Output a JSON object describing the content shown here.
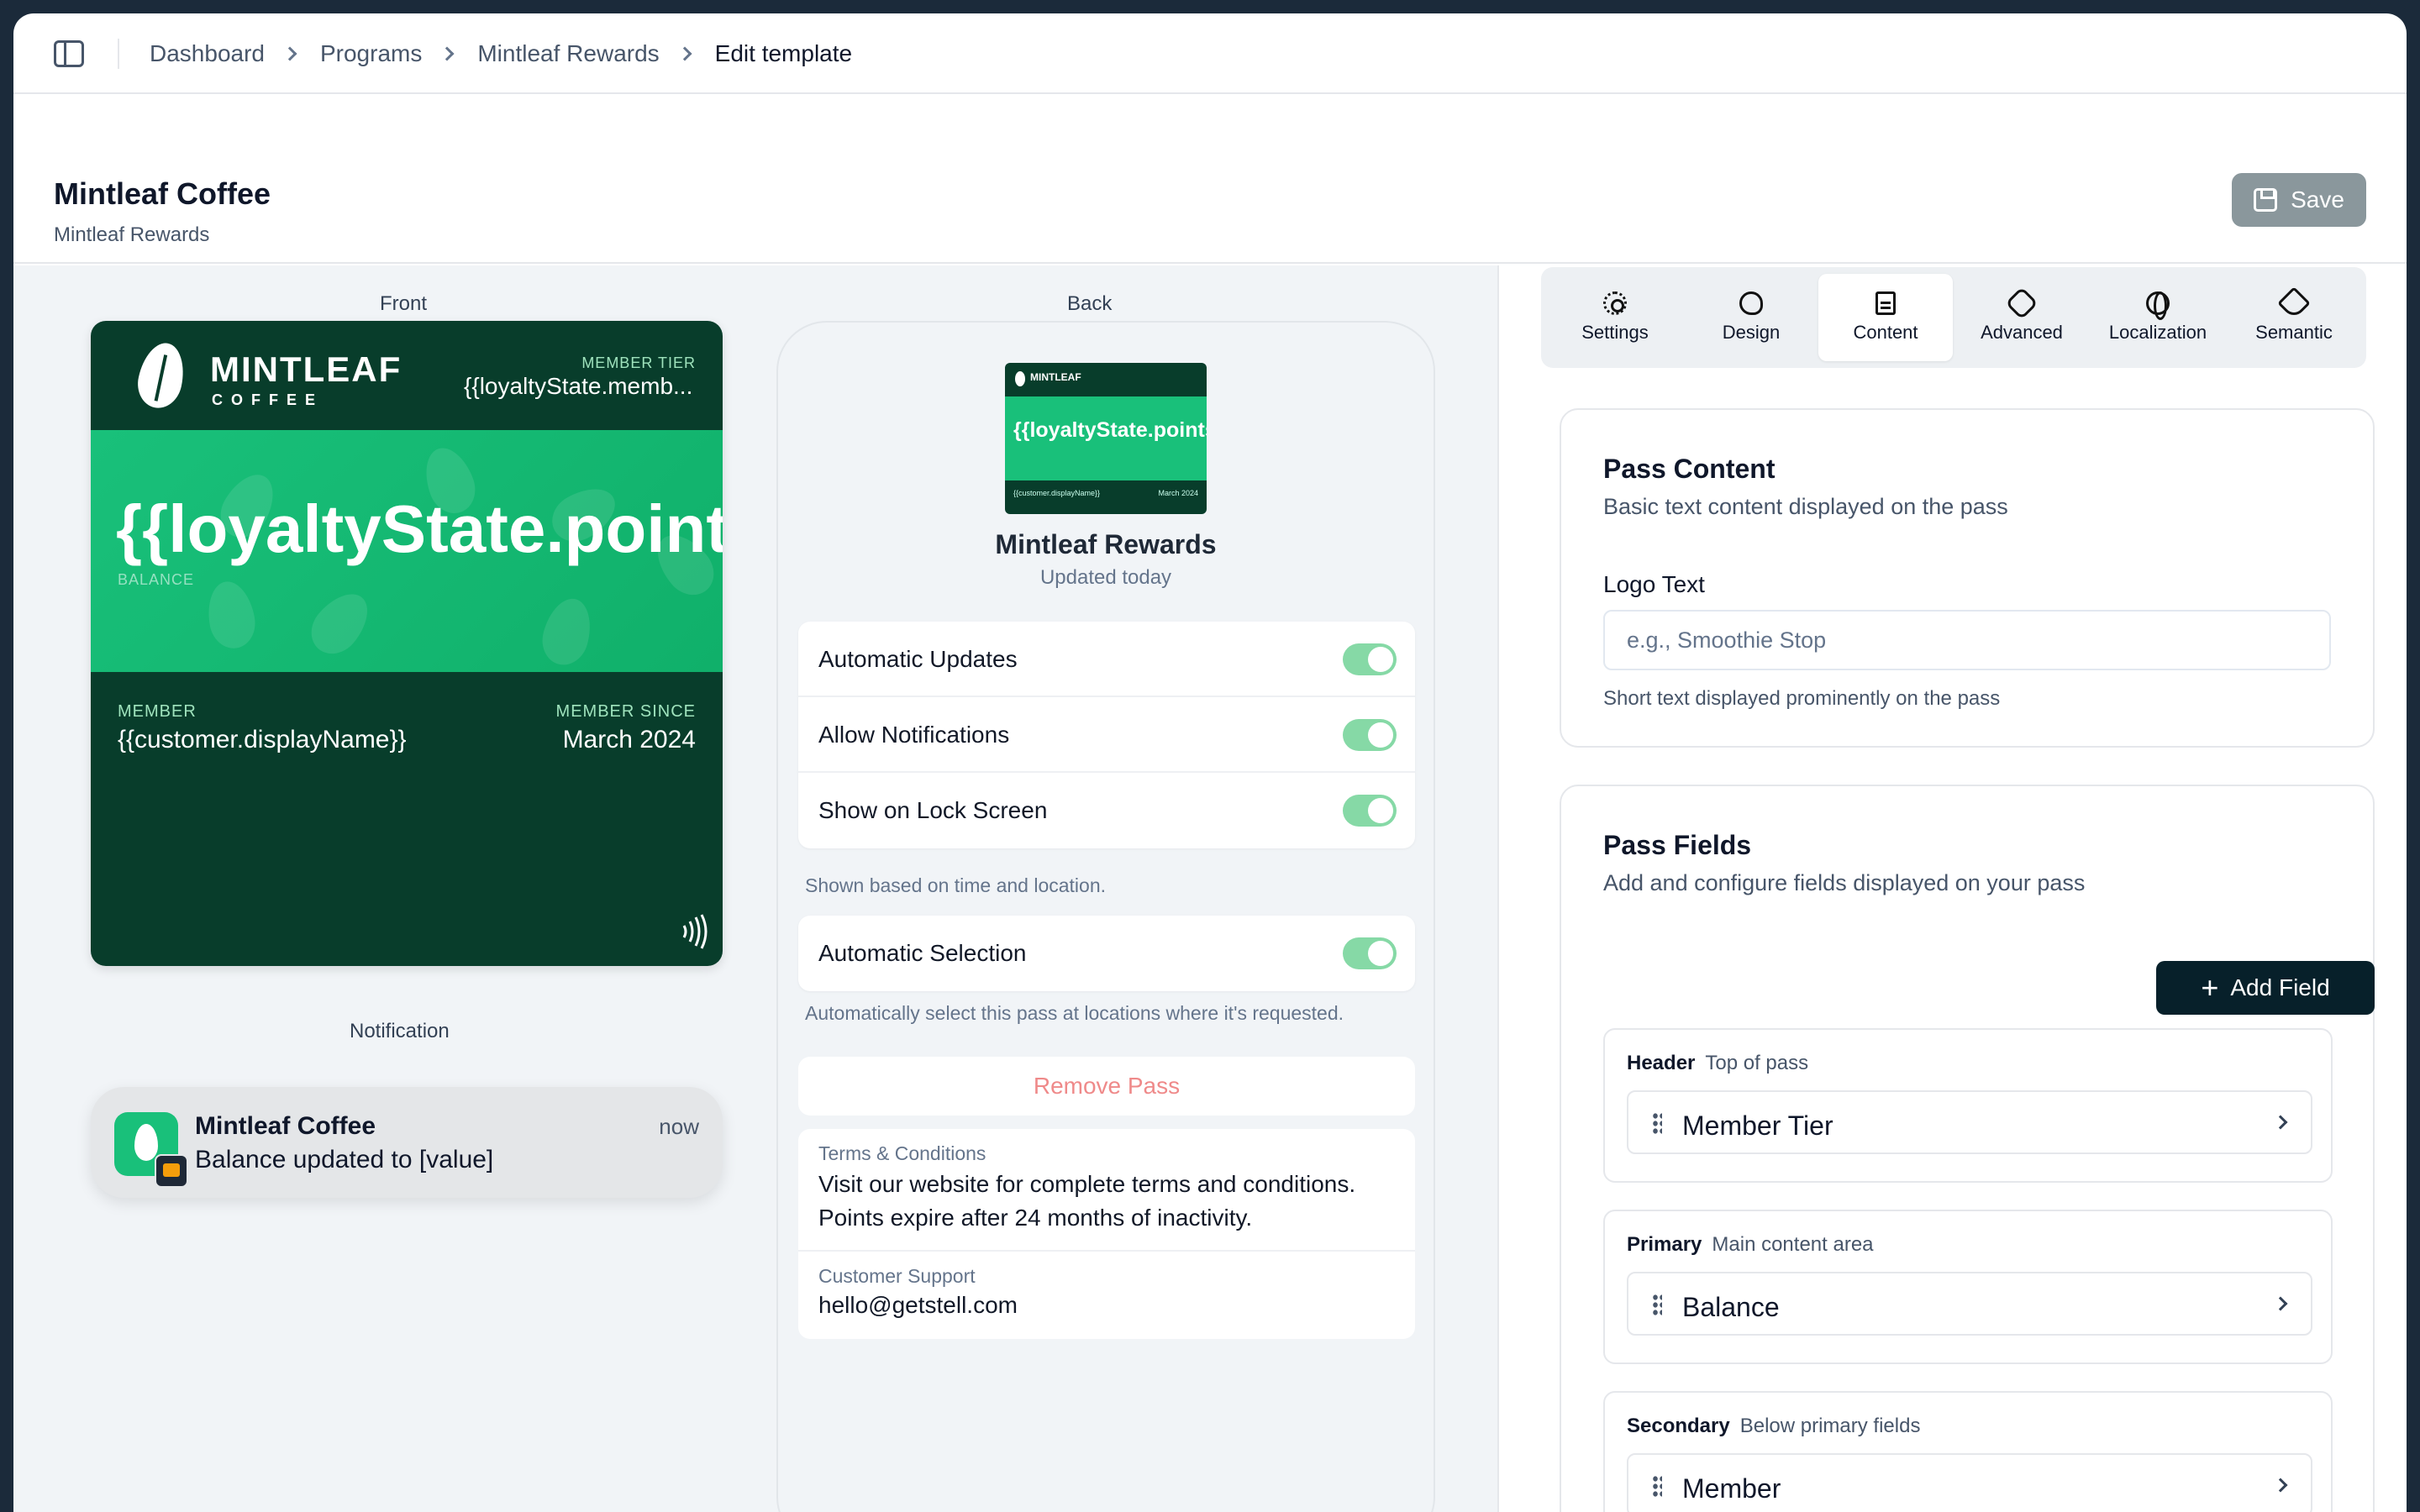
{
  "breadcrumbs": [
    "Dashboard",
    "Programs",
    "Mintleaf Rewards",
    "Edit template"
  ],
  "header": {
    "title": "Mintleaf Coffee",
    "subtitle": "Mintleaf Rewards",
    "save_label": "Save"
  },
  "preview": {
    "front_label": "Front",
    "back_label": "Back",
    "notification_label": "Notification",
    "card": {
      "brand": "MINTLEAF",
      "brand_sub": "COFFEE",
      "tier_label": "MEMBER TIER",
      "tier_value": "{{loyaltyState.memb...",
      "points": "{{loyaltyState.points",
      "balance_label": "BALANCE",
      "member_label": "MEMBER",
      "member_value": "{{customer.displayName}}",
      "since_label": "MEMBER SINCE",
      "since_value": "March 2024"
    },
    "notification": {
      "title": "Mintleaf Coffee",
      "time": "now",
      "body": "Balance updated to [value]"
    },
    "back": {
      "mini_brand": "MINTLEAF",
      "mini_points": "{{loyaltyState.points",
      "mini_member": "{{customer.displayName}}",
      "mini_since": "March 2024",
      "title": "Mintleaf Rewards",
      "updated": "Updated today",
      "toggles": [
        "Automatic Updates",
        "Allow Notifications",
        "Show on Lock Screen"
      ],
      "lock_hint": "Shown based on time and location.",
      "auto_selection": "Automatic Selection",
      "auto_hint": "Automatically select this pass at locations where it's requested.",
      "remove": "Remove Pass",
      "terms_label": "Terms & Conditions",
      "terms_value": "Visit our website for complete terms and conditions. Points expire after 24 months of inactivity.",
      "support_label": "Customer Support",
      "support_value": "hello@getstell.com"
    }
  },
  "tabs": [
    {
      "label": "Settings",
      "icon": "gear-icon"
    },
    {
      "label": "Design",
      "icon": "palette-icon"
    },
    {
      "label": "Content",
      "icon": "document-icon",
      "active": true
    },
    {
      "label": "Advanced",
      "icon": "badge-icon"
    },
    {
      "label": "Localization",
      "icon": "globe-icon"
    },
    {
      "label": "Semantic",
      "icon": "tag-icon"
    }
  ],
  "pass_content": {
    "title": "Pass Content",
    "desc": "Basic text content displayed on the pass",
    "logo_label": "Logo Text",
    "logo_placeholder": "e.g., Smoothie Stop",
    "logo_hint": "Short text displayed prominently on the pass"
  },
  "pass_fields": {
    "title": "Pass Fields",
    "desc": "Add and configure fields displayed on your pass",
    "add_label": "Add Field",
    "groups": [
      {
        "name": "Header",
        "desc": "Top of pass",
        "item": "Member Tier"
      },
      {
        "name": "Primary",
        "desc": "Main content area",
        "item": "Balance"
      },
      {
        "name": "Secondary",
        "desc": "Below primary fields",
        "item": "Member"
      }
    ]
  },
  "colors": {
    "card_dark": "#083d2b",
    "card_green": "#19c07a",
    "toggle_on": "#86d9a6",
    "primary_button": "#07202a"
  }
}
